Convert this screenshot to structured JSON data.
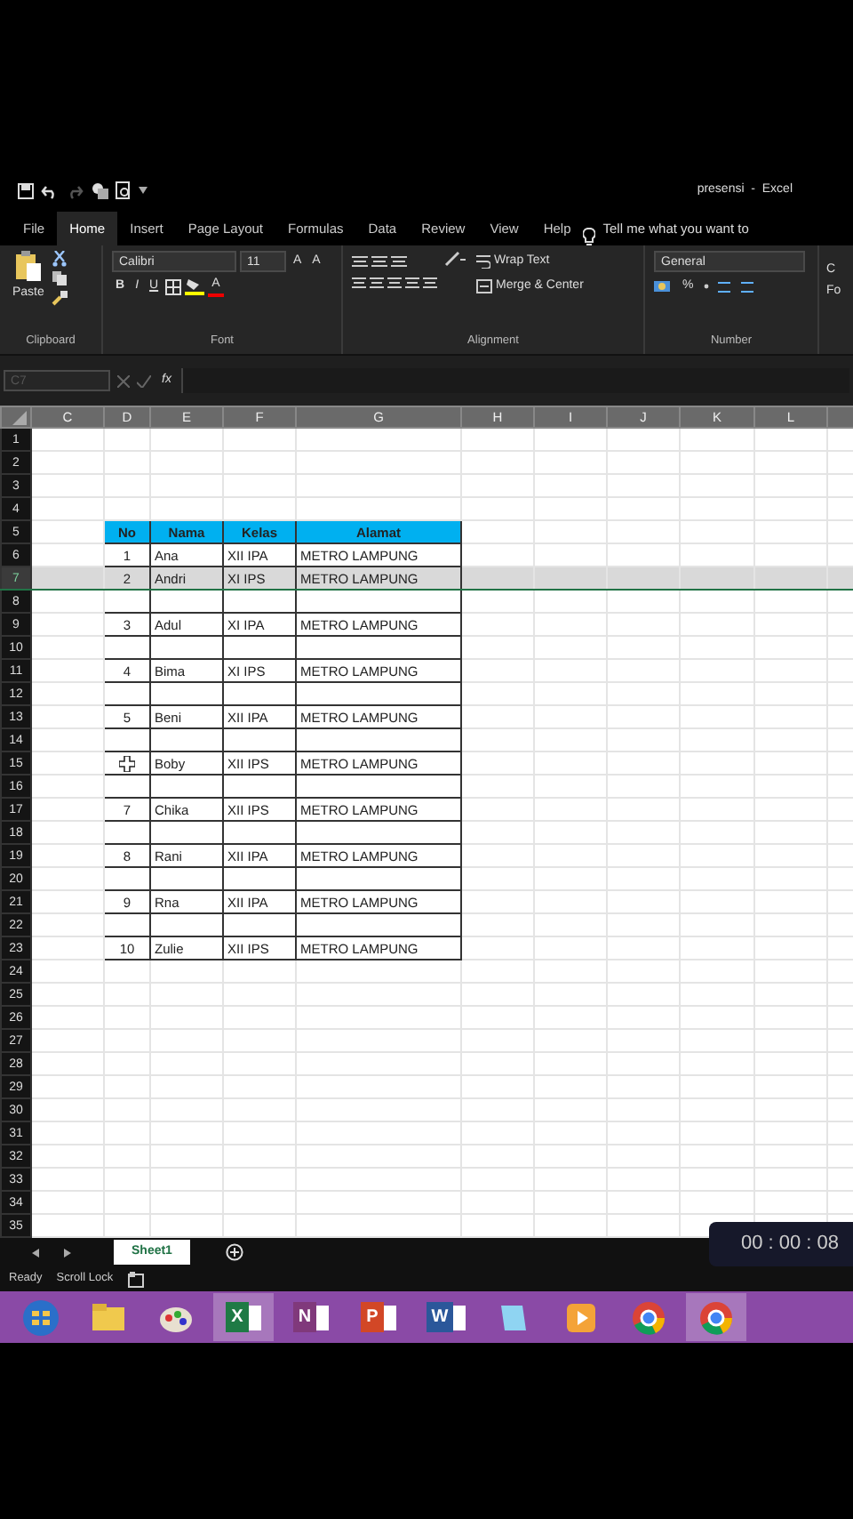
{
  "title_bar": {
    "title": "presensi  -  Excel"
  },
  "ribbon_tabs": [
    {
      "label": "File",
      "selected": false
    },
    {
      "label": "Home",
      "selected": true
    },
    {
      "label": "Insert",
      "selected": false
    },
    {
      "label": "Page Layout",
      "selected": false
    },
    {
      "label": "Formulas",
      "selected": false
    },
    {
      "label": "Data",
      "selected": false
    },
    {
      "label": "Review",
      "selected": false
    },
    {
      "label": "View",
      "selected": false
    },
    {
      "label": "Help",
      "selected": false
    }
  ],
  "tell_me": "Tell me what you want to",
  "ribbon": {
    "clipboard": {
      "paste": "Paste",
      "label": "Clipboard"
    },
    "font": {
      "name": "Calibri",
      "size": "11",
      "grow": "A",
      "shrink": "A",
      "bold": "B",
      "italic": "I",
      "underline": "U",
      "font_color": "A",
      "label": "Font"
    },
    "alignment": {
      "wrap": "Wrap Text",
      "merge": "Merge & Center",
      "label": "Alignment"
    },
    "number": {
      "format": "General",
      "percent": "%",
      "label": "Number"
    },
    "partial": [
      "C",
      "Fo"
    ]
  },
  "formula_bar": {
    "name_box": "C7",
    "function_label": "fx"
  },
  "columns": [
    "C",
    "D",
    "E",
    "F",
    "G",
    "H",
    "I",
    "J",
    "K",
    "L"
  ],
  "rows": [
    {
      "label": "1",
      "kind": "plain",
      "selected": false
    },
    {
      "label": "2",
      "kind": "plain",
      "selected": false
    },
    {
      "label": "3",
      "kind": "plain",
      "selected": false
    },
    {
      "label": "4",
      "kind": "plain",
      "selected": false
    },
    {
      "label": "5",
      "kind": "header",
      "selected": false,
      "cells": [
        "No",
        "Nama",
        "Kelas",
        "Alamat"
      ]
    },
    {
      "label": "6",
      "kind": "record",
      "selected": false,
      "cells": [
        "1",
        "Ana",
        "XII IPA",
        "METRO LAMPUNG"
      ]
    },
    {
      "label": "7",
      "kind": "record",
      "selected": true,
      "cells": [
        "2",
        "Andri",
        "XI IPS",
        "METRO LAMPUNG"
      ]
    },
    {
      "label": "8",
      "kind": "gap",
      "selected": false
    },
    {
      "label": "9",
      "kind": "record",
      "selected": false,
      "cells": [
        "3",
        "Adul",
        "XI IPA",
        "METRO LAMPUNG"
      ]
    },
    {
      "label": "10",
      "kind": "gap",
      "selected": false
    },
    {
      "label": "11",
      "kind": "record",
      "selected": false,
      "cells": [
        "4",
        "Bima",
        "XI IPS",
        "METRO LAMPUNG"
      ]
    },
    {
      "label": "12",
      "kind": "gap",
      "selected": false
    },
    {
      "label": "13",
      "kind": "record",
      "selected": false,
      "cells": [
        "5",
        "Beni",
        "XII IPA",
        "METRO LAMPUNG"
      ]
    },
    {
      "label": "14",
      "kind": "gap",
      "selected": false
    },
    {
      "label": "15",
      "kind": "record",
      "selected": false,
      "pointer": true,
      "cells": [
        null,
        "Boby",
        "XII IPS",
        "METRO LAMPUNG"
      ]
    },
    {
      "label": "16",
      "kind": "gap",
      "selected": false
    },
    {
      "label": "17",
      "kind": "record",
      "selected": false,
      "cells": [
        "7",
        "Chika",
        "XII IPS",
        "METRO LAMPUNG"
      ]
    },
    {
      "label": "18",
      "kind": "gap",
      "selected": false
    },
    {
      "label": "19",
      "kind": "record",
      "selected": false,
      "cells": [
        "8",
        "Rani",
        "XII IPA",
        "METRO LAMPUNG"
      ]
    },
    {
      "label": "20",
      "kind": "gap",
      "selected": false
    },
    {
      "label": "21",
      "kind": "record",
      "selected": false,
      "cells": [
        "9",
        "Rna",
        "XII IPA",
        "METRO LAMPUNG"
      ]
    },
    {
      "label": "22",
      "kind": "gap",
      "selected": false
    },
    {
      "label": "23",
      "kind": "record",
      "selected": false,
      "cells": [
        "10",
        "Zulie",
        "XII IPS",
        "METRO LAMPUNG"
      ]
    },
    {
      "label": "24",
      "kind": "plain",
      "selected": false
    },
    {
      "label": "25",
      "kind": "plain",
      "selected": false
    },
    {
      "label": "26",
      "kind": "plain",
      "selected": false
    },
    {
      "label": "27",
      "kind": "plain",
      "selected": false
    },
    {
      "label": "28",
      "kind": "plain",
      "selected": false
    },
    {
      "label": "29",
      "kind": "plain",
      "selected": false
    },
    {
      "label": "30",
      "kind": "plain",
      "selected": false
    },
    {
      "label": "31",
      "kind": "plain",
      "selected": false
    },
    {
      "label": "32",
      "kind": "plain",
      "selected": false
    },
    {
      "label": "33",
      "kind": "plain",
      "selected": false
    },
    {
      "label": "34",
      "kind": "plain",
      "selected": false
    },
    {
      "label": "35",
      "kind": "plain",
      "selected": false
    }
  ],
  "sheet_tabs": [
    {
      "label": "Sheet1",
      "selected": true
    }
  ],
  "status_bar": [
    "Ready",
    "Scroll Lock"
  ],
  "recorder": {
    "time": "00 : 00 : 08"
  },
  "taskbar": [
    {
      "kind": "start",
      "active": false
    },
    {
      "kind": "folder",
      "active": false
    },
    {
      "kind": "paint",
      "active": false
    },
    {
      "kind": "app",
      "glyph": "X",
      "color": "#1e7a45",
      "active": true
    },
    {
      "kind": "app",
      "glyph": "N",
      "color": "#80397b",
      "active": false
    },
    {
      "kind": "app",
      "glyph": "P",
      "color": "#d24726",
      "active": false
    },
    {
      "kind": "app",
      "glyph": "W",
      "color": "#2b579a",
      "active": false
    },
    {
      "kind": "notes",
      "active": false
    },
    {
      "kind": "media",
      "active": false
    },
    {
      "kind": "chrome",
      "active": false
    },
    {
      "kind": "chrome",
      "active": true
    }
  ]
}
